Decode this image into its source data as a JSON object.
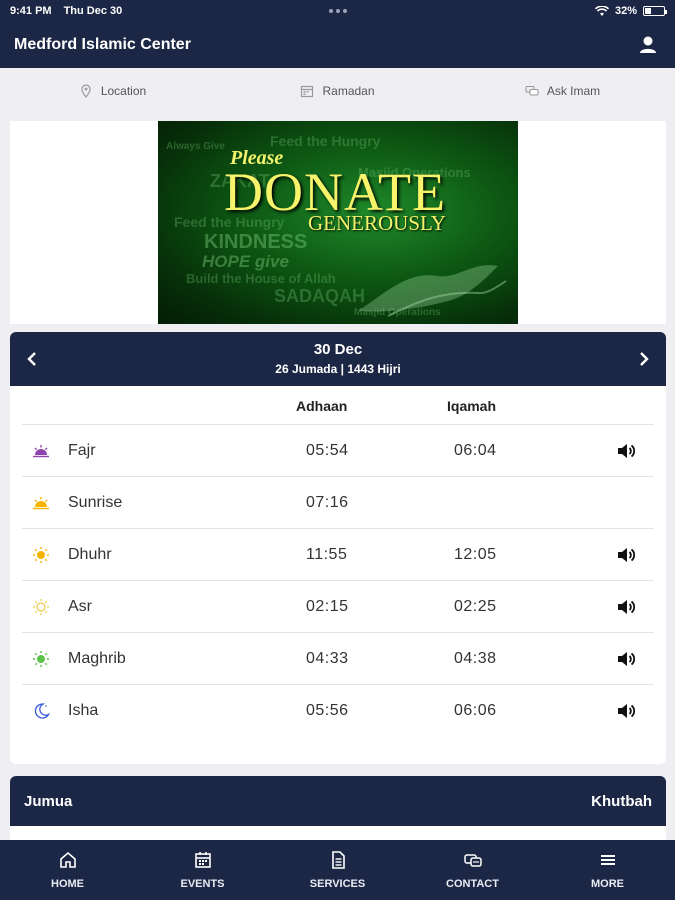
{
  "status_bar": {
    "time": "9:41 PM",
    "date": "Thu Dec 30",
    "battery": "32%",
    "battery_level": 0.32
  },
  "app": {
    "title": "Medford Islamic Center",
    "user_icon": "user-icon"
  },
  "quick_nav": [
    {
      "label": "Location",
      "icon": "map-pin-icon"
    },
    {
      "label": "Ramadan",
      "icon": "calendar-icon"
    },
    {
      "label": "Ask Imam",
      "icon": "chat-icon"
    }
  ],
  "banner": {
    "please": "Please",
    "donate": "DONATE",
    "generously": "GENEROUSLY",
    "background_words": [
      "Feed the Hungry",
      "Masjid Operations",
      "ZAKAT",
      "Feed the Hungry",
      "KINDNESS",
      "HOPE give",
      "Build the House of Allah",
      "SADAQAH",
      "Masjid Operations",
      "Always Give"
    ]
  },
  "prayer_card": {
    "date": "30 Dec",
    "hijri": "26 Jumada | 1443 Hijri",
    "col_adhaan": "Adhaan",
    "col_iqamah": "Iqamah",
    "prayers": [
      {
        "name": "Fajr",
        "adhaan": "05:54",
        "iqamah": "06:04",
        "icon": "sunrise-icon",
        "icon_color": "#8e44ad",
        "speaker": true
      },
      {
        "name": "Sunrise",
        "adhaan": "07:16",
        "iqamah": "",
        "icon": "sunrise-icon",
        "icon_color": "#f5b400",
        "speaker": false
      },
      {
        "name": "Dhuhr",
        "adhaan": "11:55",
        "iqamah": "12:05",
        "icon": "sun-icon",
        "icon_color": "#f5b400",
        "speaker": true
      },
      {
        "name": "Asr",
        "adhaan": "02:15",
        "iqamah": "02:25",
        "icon": "sun-outline-icon",
        "icon_color": "#f0c64a",
        "speaker": true
      },
      {
        "name": "Maghrib",
        "adhaan": "04:33",
        "iqamah": "04:38",
        "icon": "sunset-icon",
        "icon_color": "#5cc24a",
        "speaker": true
      },
      {
        "name": "Isha",
        "adhaan": "05:56",
        "iqamah": "06:06",
        "icon": "moon-icon",
        "icon_color": "#3b5bdb",
        "speaker": true
      }
    ]
  },
  "jumua": {
    "left": "Jumua",
    "right": "Khutbah"
  },
  "bottom_nav": [
    {
      "label": "HOME",
      "icon": "home-icon"
    },
    {
      "label": "EVENTS",
      "icon": "calendar-icon"
    },
    {
      "label": "SERVICES",
      "icon": "document-icon"
    },
    {
      "label": "CONTACT",
      "icon": "contact-icon"
    },
    {
      "label": "MORE",
      "icon": "menu-icon"
    }
  ],
  "colors": {
    "navy": "#1c2745",
    "background": "#efeff3"
  }
}
